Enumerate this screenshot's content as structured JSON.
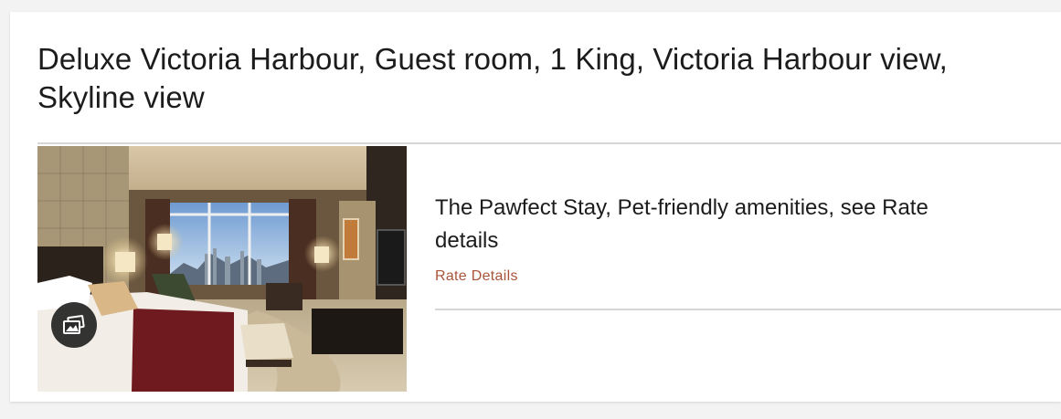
{
  "room": {
    "title": "Deluxe Victoria Harbour, Guest room, 1 King, Victoria Harbour view, Skyline view"
  },
  "gallery": {
    "icon": "gallery-icon"
  },
  "rate": {
    "name": "The Pawfect Stay, Pet-friendly amenities, see Rate details",
    "details_link": "Rate Details"
  },
  "colors": {
    "link": "#a9543a",
    "divider": "#d6d6d6",
    "text": "#1c1c1c",
    "page_bg": "#f3f3f3"
  }
}
